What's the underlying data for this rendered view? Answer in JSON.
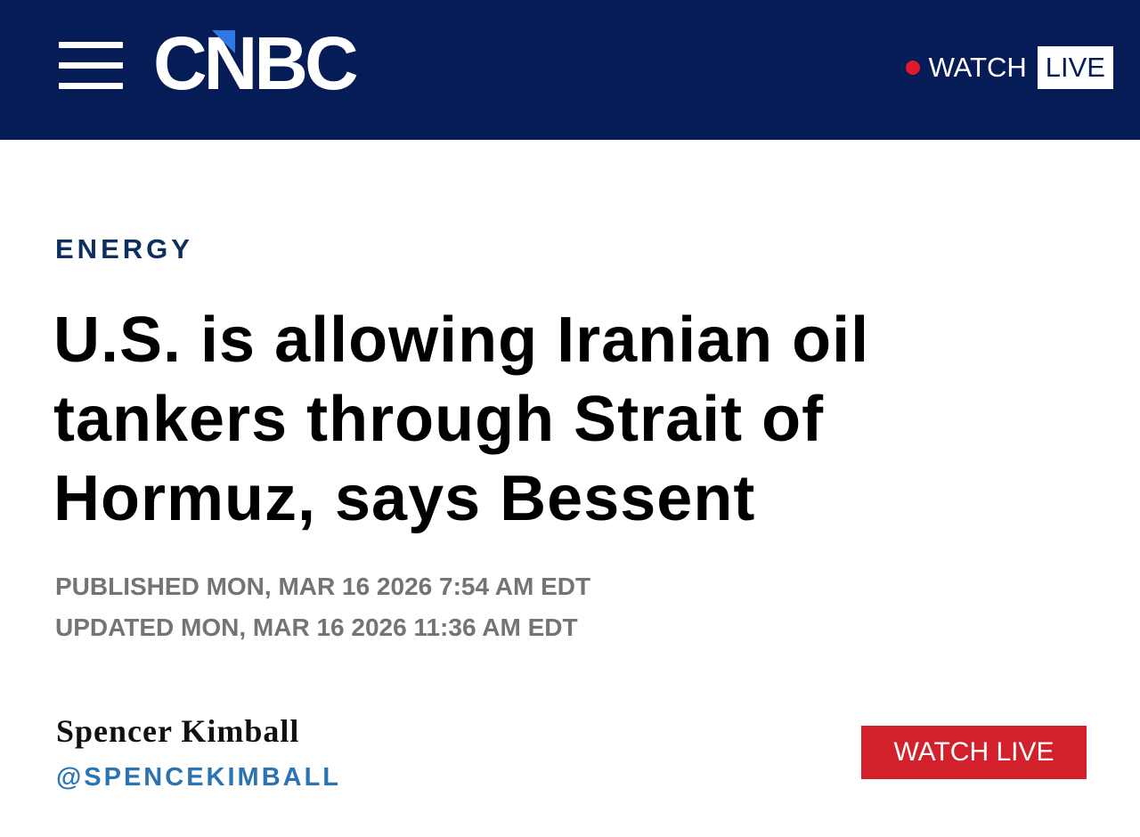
{
  "header": {
    "logo_text": "CNBC",
    "watch_label": "WATCH",
    "live_label": "LIVE"
  },
  "article": {
    "section": "ENERGY",
    "headline": "U.S. is allowing Iranian oil tankers through Strait of Hormuz, says Bessent",
    "published": "PUBLISHED MON, MAR 16 2026 7:54 AM EDT",
    "updated": "UPDATED MON, MAR 16 2026 11:36 AM EDT",
    "author": "Spencer Kimball",
    "author_handle": "@SPENCEKIMBALL",
    "watch_live_button": "WATCH LIVE"
  },
  "colors": {
    "header_bg": "#061c56",
    "section_label": "#0d2e5e",
    "meta_gray": "#747474",
    "handle_blue": "#2b74b2",
    "watch_live_red": "#d3212c",
    "live_dot_red": "#e0182d",
    "logo_accent": "#2f77e3"
  },
  "icons": {
    "menu": "hamburger-menu-icon",
    "live_indicator": "live-dot-icon"
  }
}
